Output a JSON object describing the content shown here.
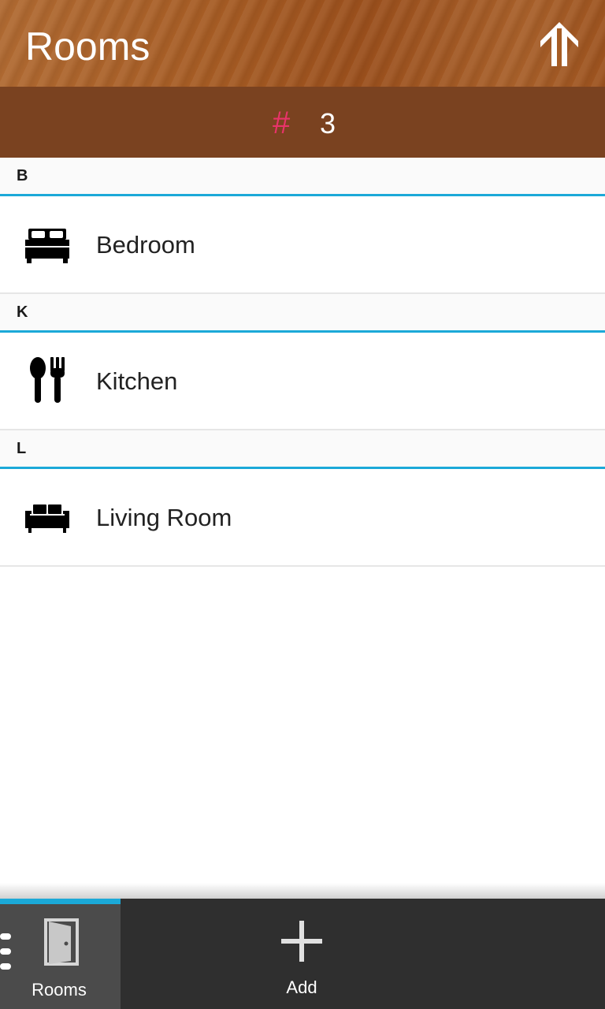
{
  "title_bar": {
    "title": "Rooms",
    "up_icon": "arrow-up-icon"
  },
  "count_bar": {
    "symbol": "#",
    "count": "3",
    "symbol_color": "#e8336a"
  },
  "accent_color": "#1ba9d8",
  "sections": [
    {
      "letter": "B",
      "item": {
        "label": "Bedroom",
        "icon": "bed-icon"
      }
    },
    {
      "letter": "K",
      "item": {
        "label": "Kitchen",
        "icon": "utensils-icon"
      }
    },
    {
      "letter": "L",
      "item": {
        "label": "Living Room",
        "icon": "sofa-icon"
      }
    }
  ],
  "bottom_bar": {
    "tabs": [
      {
        "label": "Rooms",
        "icon": "door-icon",
        "selected": true
      },
      {
        "label": "Add",
        "icon": "plus-icon",
        "selected": false
      }
    ],
    "overflow_icon": "overflow-menu-icon"
  }
}
